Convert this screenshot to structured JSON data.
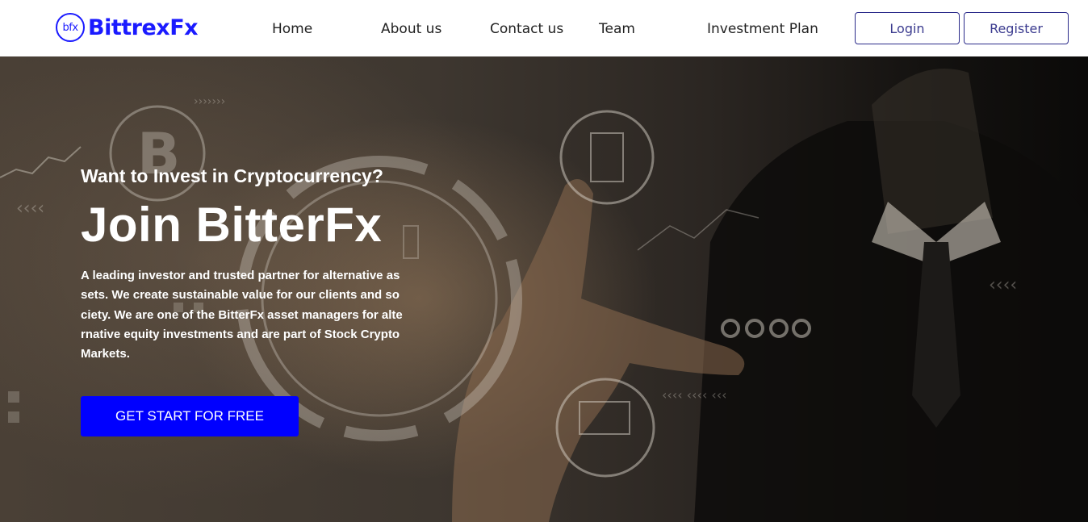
{
  "brand": {
    "logo_mark": "bfx",
    "name": "BittrexFx",
    "color": "#1a1aff"
  },
  "nav": {
    "items": [
      {
        "label": "Home"
      },
      {
        "label": "About us"
      },
      {
        "label": "Contact us"
      },
      {
        "label": "Team"
      },
      {
        "label": "Investment Plan"
      }
    ],
    "login_label": "Login",
    "register_label": "Register"
  },
  "hero": {
    "tagline": "Want to Invest in Cryptocurrency?",
    "headline": "Join BitterFx",
    "description": "A leading investor and trusted partner for alternative assets. We create sustainable value for our clients and society. We are one of the BitterFx asset managers for alternative equity investments and are part of Stock Crypto Markets.",
    "cta_label": "GET START FOR FREE",
    "cta_color": "#0000ff"
  }
}
